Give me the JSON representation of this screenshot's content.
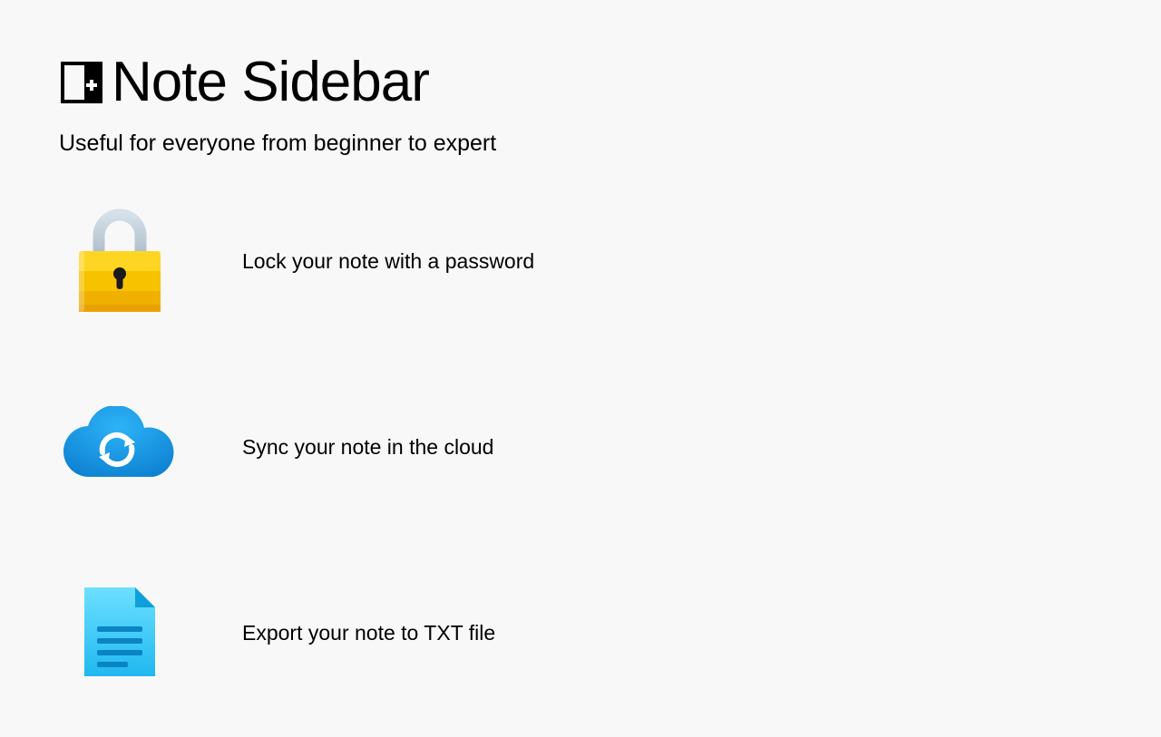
{
  "header": {
    "title": "Note Sidebar",
    "subtitle": "Useful for everyone from beginner to expert"
  },
  "features": [
    {
      "text": "Lock your note with a password",
      "icon": "lock-icon"
    },
    {
      "text": "Sync your note in the cloud",
      "icon": "cloud-sync-icon"
    },
    {
      "text": "Export your note to TXT file",
      "icon": "export-file-icon"
    }
  ],
  "colors": {
    "lock_body_top": "#FFCB00",
    "lock_body_bottom": "#E8A200",
    "lock_shackle": "#C0CFD8",
    "cloud": "#1696E6",
    "file_top": "#5BD7FF",
    "file_bottom": "#2AB8F0"
  }
}
